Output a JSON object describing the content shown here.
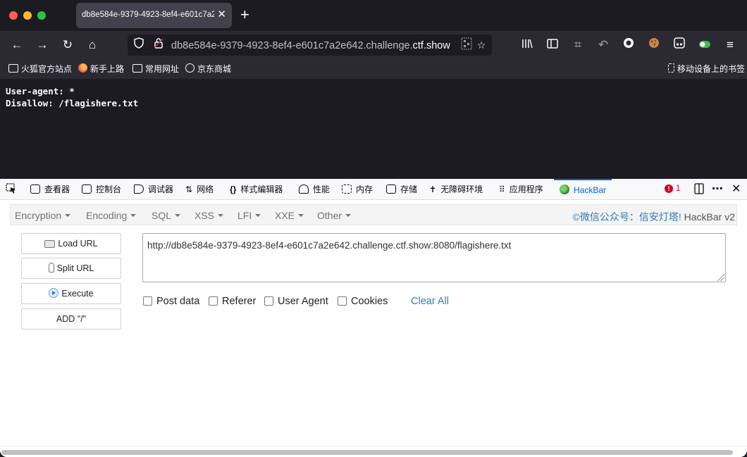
{
  "browser": {
    "tab_title": "db8e584e-9379-4923-8ef4-e601c7a2e642.challenge.ctf.show",
    "tab_close": "✕",
    "new_tab": "+",
    "url_prefix": "db8e584e-9379-4923-8ef4-e601c7a2e642.challenge.",
    "url_domain": "ctf.show",
    "bookmarks": [
      {
        "label": "火狐官方站点",
        "icon": "folder-icon"
      },
      {
        "label": "新手上路",
        "icon": "firefox-icon"
      },
      {
        "label": "常用网址",
        "icon": "folder-icon"
      },
      {
        "label": "京东商城",
        "icon": "globe-icon"
      }
    ],
    "mobile_bookmarks": "移动设备上的书签"
  },
  "page": {
    "lines": [
      "User-agent: *",
      "Disallow: /flagishere.txt"
    ]
  },
  "devtools": {
    "tabs": [
      "查看器",
      "控制台",
      "调试器",
      "网络",
      "样式编辑器",
      "性能",
      "内存",
      "存储",
      "无障碍环境",
      "应用程序",
      "HackBar"
    ],
    "active_tab": "HackBar",
    "error_count": "1",
    "error_mark": "!"
  },
  "hackbar": {
    "menu": [
      "Encryption",
      "Encoding",
      "SQL",
      "XSS",
      "LFI",
      "XXE",
      "Other"
    ],
    "brand_prefix": "©微信公众号：",
    "brand_name": "信安灯塔!",
    "brand_suffix": " HackBar v2",
    "buttons": {
      "load_url": "Load URL",
      "split_url": "Split URL",
      "execute": "Execute",
      "add_slash": "ADD \"/\""
    },
    "url_value": "http://db8e584e-9379-4923-8ef4-e601c7a2e642.challenge.ctf.show:8080/flagishere.txt",
    "options": [
      "Post data",
      "Referer",
      "User Agent",
      "Cookies"
    ],
    "clear_all": "Clear All"
  }
}
